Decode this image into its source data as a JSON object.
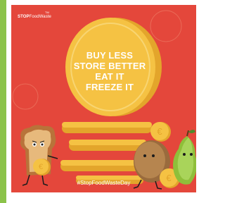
{
  "brand": {
    "name_bold": "STOP",
    "name_light": "FoodWaste",
    "mark": "TM"
  },
  "slogan": {
    "line1": "BUY LESS",
    "line2": "STORE BETTER",
    "line3": "EAT IT",
    "line4": "FREEZE IT"
  },
  "hashtag": "#StopFoodWasteDay",
  "coin_symbol": "€",
  "colors": {
    "background": "#e4473b",
    "coin": "#f5c243",
    "coin_edge": "#e3a52b",
    "accent_bar": "#8bc34a",
    "text": "#ffffff"
  }
}
